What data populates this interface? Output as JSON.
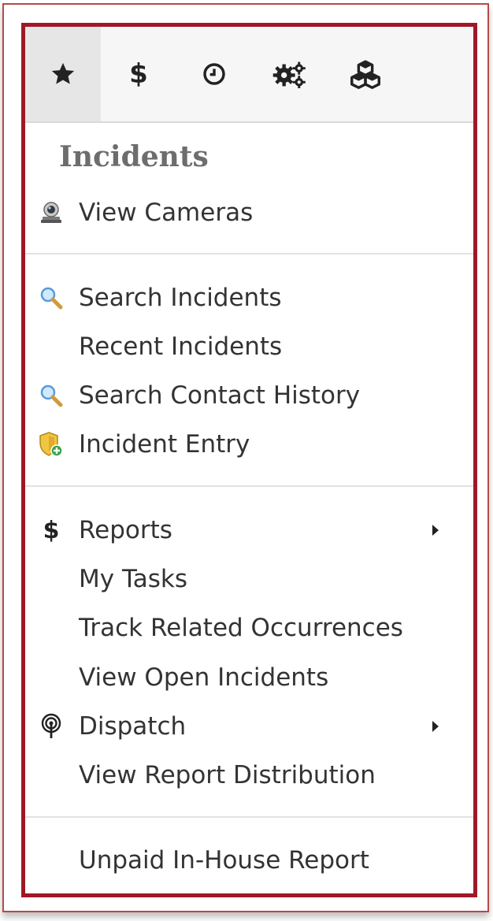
{
  "toolbar": {
    "tabs": [
      {
        "icon": "star-icon",
        "active": true
      },
      {
        "icon": "dollar-icon",
        "glyph": "$"
      },
      {
        "icon": "clock-icon"
      },
      {
        "icon": "gears-icon"
      },
      {
        "icon": "cubes-icon"
      }
    ]
  },
  "menu": {
    "section_title": "Incidents",
    "items": {
      "view_cameras": "View Cameras",
      "search_incidents": "Search Incidents",
      "recent_incidents": "Recent Incidents",
      "search_contact_history": "Search Contact History",
      "incident_entry": "Incident Entry",
      "reports": "Reports",
      "reports_icon": "$",
      "my_tasks": "My Tasks",
      "track_related_occurrences": "Track Related Occurrences",
      "view_open_incidents": "View Open Incidents",
      "dispatch": "Dispatch",
      "view_report_distribution": "View Report Distribution",
      "unpaid_in_house_report": "Unpaid In-House Report"
    }
  },
  "colors": {
    "highlight_border": "#a01826",
    "toolbar_bg": "#f6f6f6",
    "active_tab_bg": "#e6e6e6",
    "section_title": "#6d6d6d",
    "item_text": "#333333"
  }
}
